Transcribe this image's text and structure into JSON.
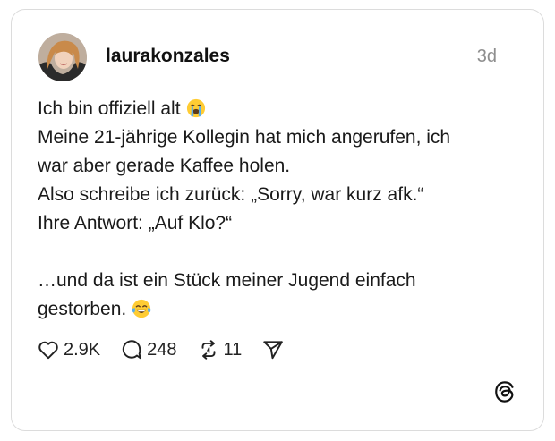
{
  "post": {
    "username": "laurakonzales",
    "time": "3d",
    "lines": [
      "Ich bin offiziell alt",
      "Meine 21-jährige Kollegin hat mich angerufen, ich",
      "war aber gerade Kaffee holen.",
      "Also schreibe ich zurück: „Sorry, war kurz afk.“",
      "Ihre Antwort: „Auf Klo?“",
      "",
      "…und da ist ein Stück meiner Jugend einfach",
      "gestorben."
    ],
    "emojis": {
      "line_1": "crying-face-emoji",
      "line_8": "tears-of-joy-emoji"
    }
  },
  "actions": {
    "likes": "2.9K",
    "comments": "248",
    "reposts": "11"
  },
  "icons": {
    "like": "heart-icon",
    "comment": "comment-bubble-icon",
    "repost": "repost-icon",
    "share": "send-icon",
    "brand": "threads-logo-icon"
  }
}
